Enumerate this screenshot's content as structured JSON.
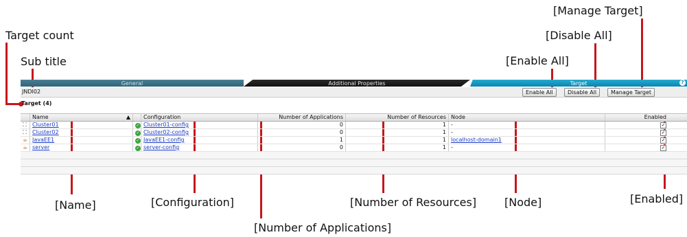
{
  "annotations": {
    "target_count": "Target count",
    "sub_title": "Sub title",
    "enable_all": "[Enable All]",
    "disable_all": "[Disable All]",
    "manage_target": "[Manage Target]",
    "name": "[Name]",
    "configuration": "[Configuration]",
    "number_of_applications": "[Number of Applications]",
    "number_of_resources": "[Number of Resources]",
    "node": "[Node]",
    "enabled": "[Enabled]"
  },
  "tabs": [
    {
      "label": "General"
    },
    {
      "label": "Additional Properties"
    },
    {
      "label": "Target",
      "active": true
    }
  ],
  "subtitle": "JNDI02",
  "buttons": {
    "enable_all": "Enable All",
    "disable_all": "Disable All",
    "manage_target": "Manage Target"
  },
  "target_count_label": "Target (4)",
  "table": {
    "headers": {
      "name": "Name",
      "sort": "▲",
      "configuration": "Configuration",
      "applications": "Number of Applications",
      "resources": "Number of Resources",
      "node": "Node",
      "enabled": "Enabled"
    },
    "rows": [
      {
        "name": "Cluster01",
        "configuration": "Cluster01-config",
        "applications": "0",
        "resources": "1",
        "node": "-",
        "node_link": false,
        "enabled": true,
        "icon": "cluster-icon"
      },
      {
        "name": "Cluster02",
        "configuration": "Cluster02-config",
        "applications": "0",
        "resources": "1",
        "node": "-",
        "node_link": false,
        "enabled": true,
        "icon": "cluster-icon"
      },
      {
        "name": "JavaEE1",
        "configuration": "JavaEE1-config",
        "applications": "1",
        "resources": "1",
        "node": "localhost-domain1",
        "node_link": true,
        "enabled": true,
        "icon": "server-icon"
      },
      {
        "name": "server",
        "configuration": "server-config",
        "applications": "0",
        "resources": "1",
        "node": "-",
        "node_link": false,
        "enabled": true,
        "icon": "server-icon"
      }
    ]
  },
  "colors": {
    "annotation": "#c4161c",
    "active_tab": "#0a86b0",
    "link": "#1a3cc4"
  }
}
